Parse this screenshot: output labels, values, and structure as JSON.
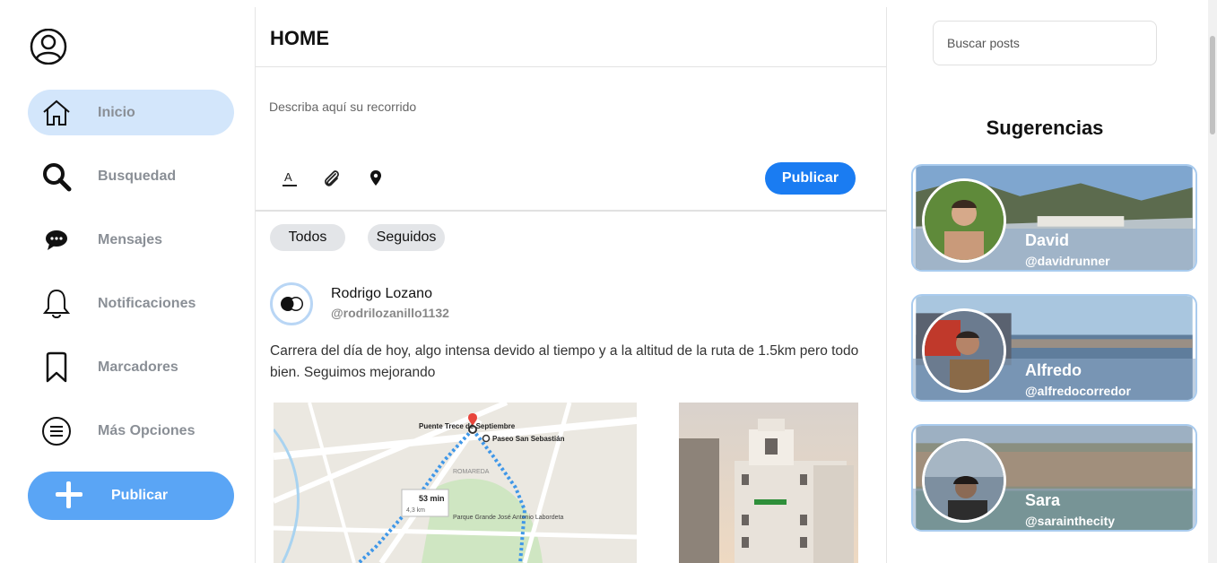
{
  "sidebar": {
    "items": [
      {
        "label": "Inicio",
        "icon": "home-icon",
        "active": true
      },
      {
        "label": "Busquedad",
        "icon": "search-icon"
      },
      {
        "label": "Mensajes",
        "icon": "chat-icon"
      },
      {
        "label": "Notificaciones",
        "icon": "bell-icon"
      },
      {
        "label": "Marcadores",
        "icon": "bookmark-icon"
      },
      {
        "label": "Más Opciones",
        "icon": "menu-circle-icon"
      }
    ],
    "publish_label": "Publicar"
  },
  "main": {
    "title": "HOME",
    "composer": {
      "placeholder": "Describa aquí su recorrido",
      "publish_label": "Publicar"
    },
    "filters": [
      "Todos",
      "Seguidos"
    ],
    "post": {
      "name": "Rodrigo Lozano",
      "handle": "@rodrilozanillo1132",
      "text": "Carrera del día de hoy, algo intensa devido al tiempo y a la altitud de la ruta de 1.5km pero todo bien. Seguimos mejorando",
      "map": {
        "labels": [
          "Puente Trece de Septiembre",
          "Paseo San Sebastián",
          "Parque Grande José Antonio Labordeta",
          "ROMAREDA"
        ],
        "route_time": "53 min",
        "route_distance": "4,3 km"
      }
    }
  },
  "right": {
    "search_placeholder": "Buscar posts",
    "suggestions_title": "Sugerencias",
    "suggestions": [
      {
        "name": "David",
        "handle": "@davidrunner"
      },
      {
        "name": "Alfredo",
        "handle": "@alfredocorredor"
      },
      {
        "name": "Sara",
        "handle": "@sarainthecity"
      }
    ]
  },
  "colors": {
    "accent": "#1a7cf2",
    "accent_light": "#5aa5f5",
    "active_nav": "#d3e6fb"
  }
}
